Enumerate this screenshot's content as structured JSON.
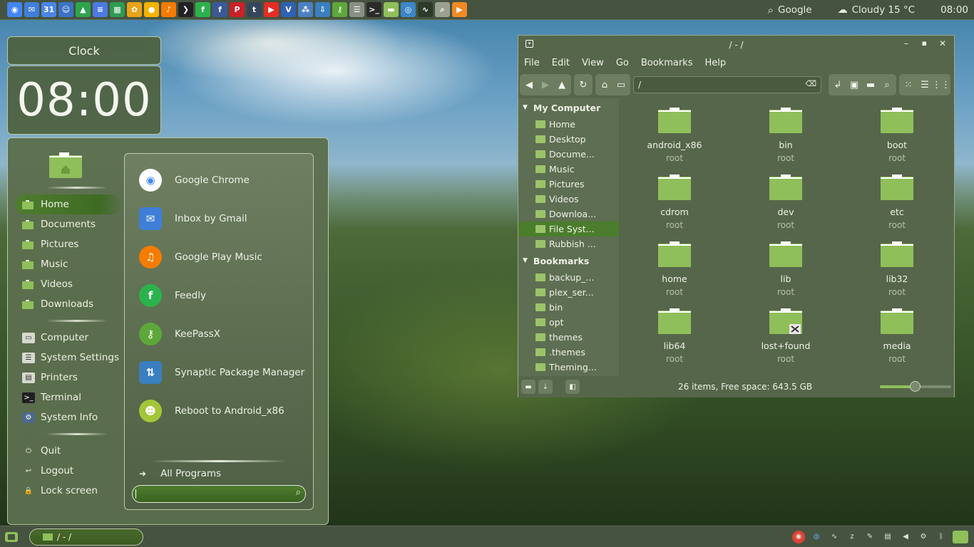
{
  "top_panel": {
    "launchers": [
      {
        "icon": "chrome-icon",
        "color": "#4285f4",
        "glyph": "◉"
      },
      {
        "icon": "inbox-icon",
        "color": "#3f7fd9",
        "glyph": "✉"
      },
      {
        "icon": "calendar-icon",
        "color": "#4a86e8",
        "glyph": "31"
      },
      {
        "icon": "contacts-icon",
        "color": "#3b73c4",
        "glyph": "☺"
      },
      {
        "icon": "drive-icon",
        "color": "#2fa44f",
        "glyph": "▲"
      },
      {
        "icon": "docs-icon",
        "color": "#4c7ae0",
        "glyph": "≡"
      },
      {
        "icon": "sheets-icon",
        "color": "#2e9a52",
        "glyph": "▦"
      },
      {
        "icon": "photos-icon",
        "color": "#e8a317",
        "glyph": "✿"
      },
      {
        "icon": "keep-icon",
        "color": "#f5b400",
        "glyph": "●"
      },
      {
        "icon": "play-music-icon",
        "color": "#f57c00",
        "glyph": "♪"
      },
      {
        "icon": "plex-icon",
        "color": "#222222",
        "glyph": "❯"
      },
      {
        "icon": "feedly-icon",
        "color": "#2bb24c",
        "glyph": "f"
      },
      {
        "icon": "facebook-icon",
        "color": "#3b5998",
        "glyph": "f"
      },
      {
        "icon": "pinterest-icon",
        "color": "#cb2027",
        "glyph": "P"
      },
      {
        "icon": "tumblr-icon",
        "color": "#35465c",
        "glyph": "t"
      },
      {
        "icon": "youtube-icon",
        "color": "#e52d27",
        "glyph": "▶"
      },
      {
        "icon": "virtualbox-icon",
        "color": "#2f61b4",
        "glyph": "V"
      },
      {
        "icon": "settings-grid-icon",
        "color": "#4a7fc1",
        "glyph": "⁂"
      },
      {
        "icon": "synaptic-icon",
        "color": "#3a7fbf",
        "glyph": "⇩"
      },
      {
        "icon": "keepassx-icon",
        "color": "#5ca83a",
        "glyph": "⚷"
      },
      {
        "icon": "system-settings-icon",
        "color": "#8a8f86",
        "glyph": "☰"
      },
      {
        "icon": "terminal-icon",
        "color": "#2b2b2b",
        "glyph": ">_"
      },
      {
        "icon": "files-icon",
        "color": "#8fbf5a",
        "glyph": "▬"
      },
      {
        "icon": "screenshot-icon",
        "color": "#3a86c8",
        "glyph": "◎"
      },
      {
        "icon": "system-monitor-icon",
        "color": "#2c3a2a",
        "glyph": "∿"
      },
      {
        "icon": "search-tool-icon",
        "color": "#9aa28f",
        "glyph": "⌕"
      },
      {
        "icon": "vlc-icon",
        "color": "#f08a24",
        "glyph": "▶"
      }
    ],
    "search_label": "Google",
    "weather": "Cloudy 15 °C",
    "time": "08:00"
  },
  "desklets": {
    "clock_title": "Clock",
    "clock_time": "08:00"
  },
  "menu": {
    "places": [
      {
        "label": "Home",
        "selected": true
      },
      {
        "label": "Documents",
        "selected": false
      },
      {
        "label": "Pictures",
        "selected": false
      },
      {
        "label": "Music",
        "selected": false
      },
      {
        "label": "Videos",
        "selected": false
      },
      {
        "label": "Downloads",
        "selected": false
      }
    ],
    "system": [
      {
        "label": "Computer",
        "icon": "monitor-icon"
      },
      {
        "label": "System Settings",
        "icon": "system-settings-icon"
      },
      {
        "label": "Printers",
        "icon": "printer-icon"
      },
      {
        "label": "Terminal",
        "icon": "terminal-icon"
      },
      {
        "label": "System Info",
        "icon": "gear-icon"
      }
    ],
    "session": [
      {
        "label": "Quit",
        "icon": "power-icon"
      },
      {
        "label": "Logout",
        "icon": "logout-icon"
      },
      {
        "label": "Lock screen",
        "icon": "lock-icon"
      }
    ],
    "favorites": [
      {
        "label": "Google Chrome",
        "icon": "chrome-icon"
      },
      {
        "label": "Inbox by Gmail",
        "icon": "inbox-icon"
      },
      {
        "label": "Google Play Music",
        "icon": "play-music-icon"
      },
      {
        "label": "Feedly",
        "icon": "feedly-icon"
      },
      {
        "label": "KeePassX",
        "icon": "keepassx-icon"
      },
      {
        "label": "Synaptic Package Manager",
        "icon": "synaptic-icon"
      },
      {
        "label": "Reboot to Android_x86",
        "icon": "android-icon"
      }
    ],
    "all_programs": "All Programs",
    "search_value": ""
  },
  "file_manager": {
    "title": "/ - /",
    "menubar": [
      "File",
      "Edit",
      "View",
      "Go",
      "Bookmarks",
      "Help"
    ],
    "path": "/",
    "sidebar": {
      "my_computer_header": "My Computer",
      "my_computer": [
        {
          "label": "Home",
          "selected": false
        },
        {
          "label": "Desktop",
          "selected": false
        },
        {
          "label": "Docume...",
          "selected": false
        },
        {
          "label": "Music",
          "selected": false
        },
        {
          "label": "Pictures",
          "selected": false
        },
        {
          "label": "Videos",
          "selected": false
        },
        {
          "label": "Downloa...",
          "selected": false
        },
        {
          "label": "File Syst...",
          "selected": true
        },
        {
          "label": "Rubbish ...",
          "selected": false
        }
      ],
      "bookmarks_header": "Bookmarks",
      "bookmarks": [
        {
          "label": "backup_..."
        },
        {
          "label": "plex_ser..."
        },
        {
          "label": "bin"
        },
        {
          "label": "opt"
        },
        {
          "label": "themes"
        },
        {
          "label": ".themes"
        },
        {
          "label": "Theming..."
        }
      ]
    },
    "items": [
      {
        "name": "android_x86",
        "owner": "root",
        "locked": false
      },
      {
        "name": "bin",
        "owner": "root",
        "locked": false
      },
      {
        "name": "boot",
        "owner": "root",
        "locked": false
      },
      {
        "name": "cdrom",
        "owner": "root",
        "locked": false
      },
      {
        "name": "dev",
        "owner": "root",
        "locked": false
      },
      {
        "name": "etc",
        "owner": "root",
        "locked": false
      },
      {
        "name": "home",
        "owner": "root",
        "locked": false
      },
      {
        "name": "lib",
        "owner": "root",
        "locked": false
      },
      {
        "name": "lib32",
        "owner": "root",
        "locked": false
      },
      {
        "name": "lib64",
        "owner": "root",
        "locked": false
      },
      {
        "name": "lost+found",
        "owner": "root",
        "locked": true
      },
      {
        "name": "media",
        "owner": "root",
        "locked": false
      }
    ],
    "status": "26 items, Free space: 643.5 GB",
    "zoom_fraction": 0.5
  },
  "bottom_panel": {
    "task_label": "/ - /",
    "tray": [
      "chrome-icon",
      "network-globe-icon",
      "system-monitor-icon",
      "sleep-icon",
      "pen-icon",
      "clipboard-icon",
      "volume-icon",
      "settings-icon",
      "bluetooth-icon",
      "workspace-icon"
    ]
  },
  "colors": {
    "folder": "#8fbf5a",
    "accent": "#4b7d2c",
    "panel": "#465340"
  }
}
